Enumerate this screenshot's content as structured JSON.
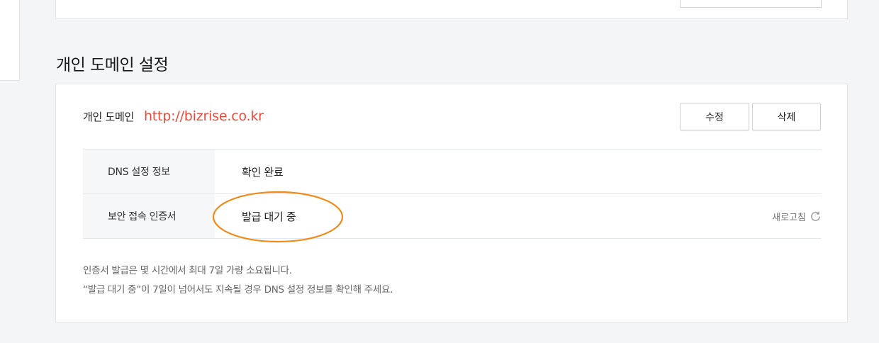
{
  "section": {
    "title": "개인 도메인 설정"
  },
  "domain": {
    "label": "개인 도메인",
    "value": "http://bizrise.co.kr"
  },
  "buttons": {
    "edit": "수정",
    "delete": "삭제"
  },
  "info": {
    "dns": {
      "key": "DNS 설정 정보",
      "value": "확인 완료"
    },
    "ssl": {
      "key": "보안 접속 인증서",
      "value": "발급 대기 중"
    },
    "refresh_label": "새로고침"
  },
  "notes": [
    "인증서 발급은 몇 시간에서 최대 7일 가량 소요됩니다.",
    "“발급 대기 중”이 7일이 넘어서도 지속될 경우 DNS 설정 정보를 확인해 주세요."
  ],
  "colors": {
    "domain_link": "#ee4a3a",
    "highlight_ellipse": "#f28a1a"
  }
}
